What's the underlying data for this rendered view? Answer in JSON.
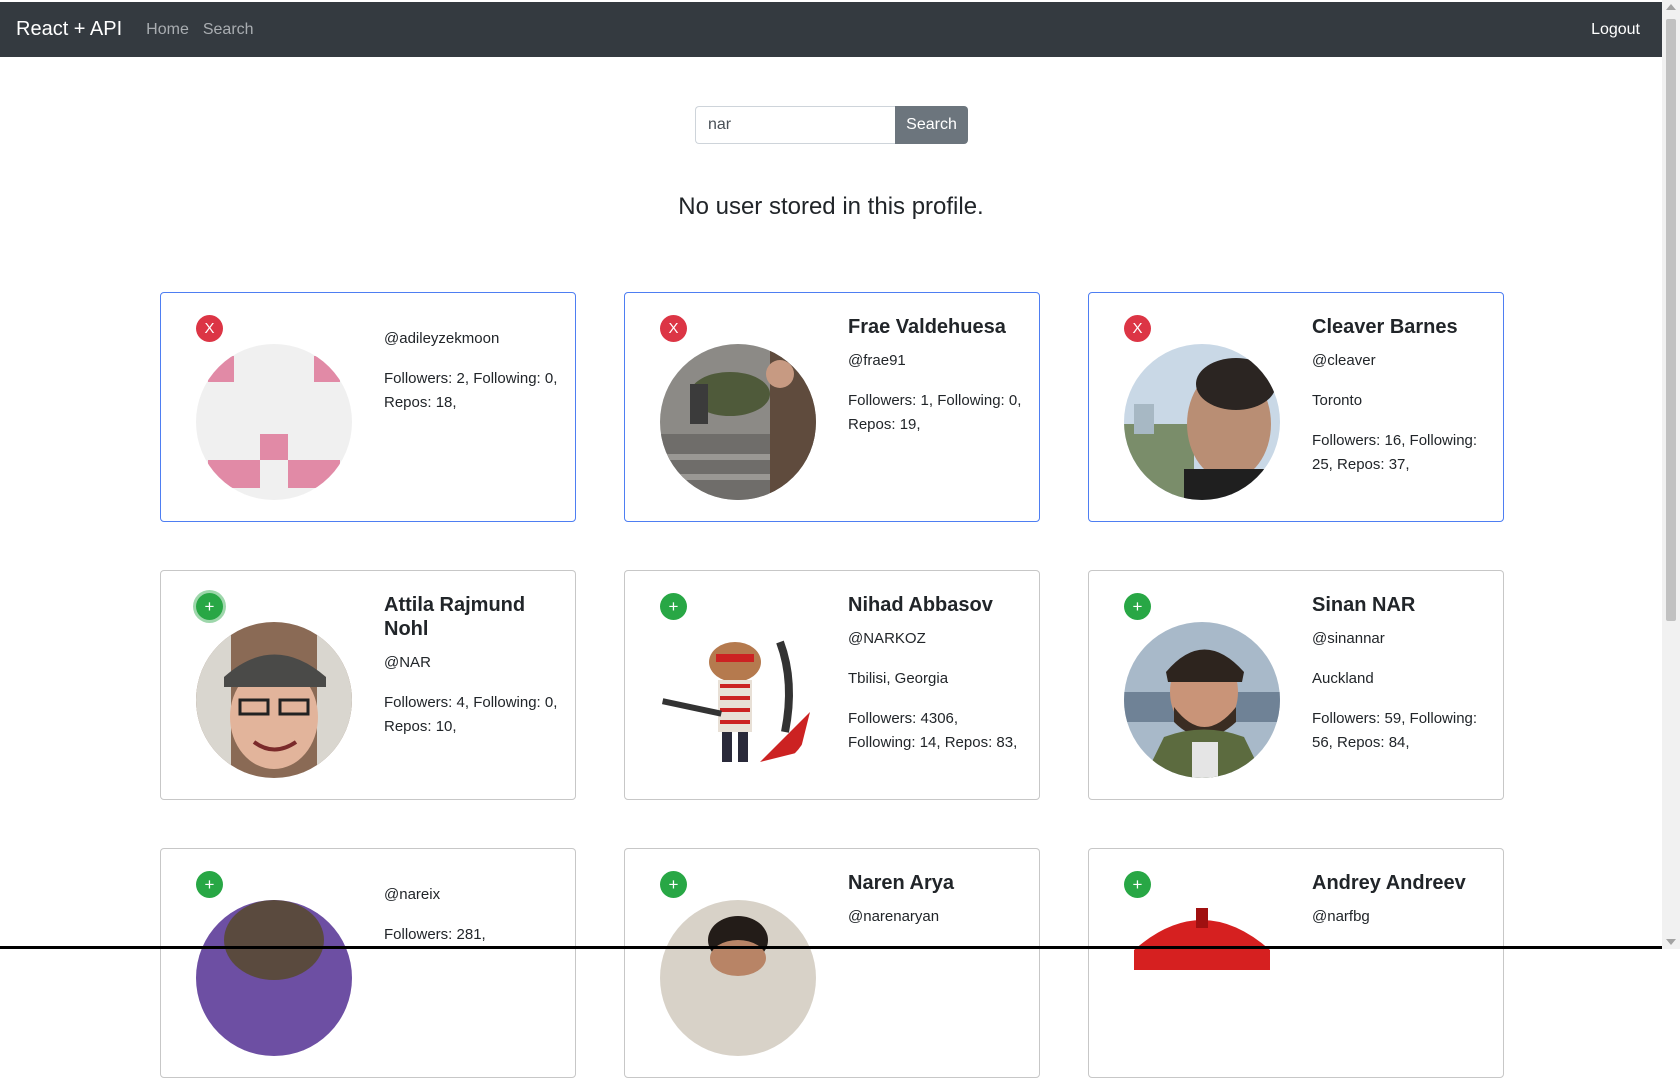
{
  "nav": {
    "brand": "React + API",
    "links": [
      "Home",
      "Search"
    ],
    "logout": "Logout"
  },
  "search": {
    "value": "nar",
    "button_label": "Search"
  },
  "notice": "No user stored in this profile.",
  "cards": [
    {
      "control": "X",
      "name": "",
      "login": "@adileyzekmoon",
      "location": "",
      "stats": "Followers: 2, Following: 0, Repos: 18,"
    },
    {
      "control": "X",
      "name": "Frae Valdehuesa",
      "login": "@frae91",
      "location": "",
      "stats": "Followers: 1, Following: 0, Repos: 19,"
    },
    {
      "control": "X",
      "name": "Cleaver Barnes",
      "login": "@cleaver",
      "location": "Toronto",
      "stats": "Followers: 16, Following: 25, Repos: 37,"
    },
    {
      "control": "+",
      "name": "Attila Rajmund Nohl",
      "login": "@NAR",
      "location": "",
      "stats": "Followers: 4, Following: 0, Repos: 10,"
    },
    {
      "control": "+",
      "name": "Nihad Abbasov",
      "login": "@NARKOZ",
      "location": "Tbilisi, Georgia",
      "stats": "Followers: 4306, Following: 14, Repos: 83,"
    },
    {
      "control": "+",
      "name": "Sinan NAR",
      "login": "@sinannar",
      "location": "Auckland",
      "stats": "Followers: 59, Following: 56, Repos: 84,"
    },
    {
      "control": "+",
      "name": "",
      "login": "@nareix",
      "location": "",
      "stats": "Followers: 281,"
    },
    {
      "control": "+",
      "name": "Naren Arya",
      "login": "@narenaryan",
      "location": "",
      "stats": ""
    },
    {
      "control": "+",
      "name": "Andrey Andreev",
      "login": "@narfbg",
      "location": "",
      "stats": ""
    }
  ],
  "colors": {
    "navbar": "#343a40",
    "remove": "#dc3545",
    "add": "#28a745",
    "stored_border": "#4e7ef2",
    "search_button": "#6c757d"
  }
}
